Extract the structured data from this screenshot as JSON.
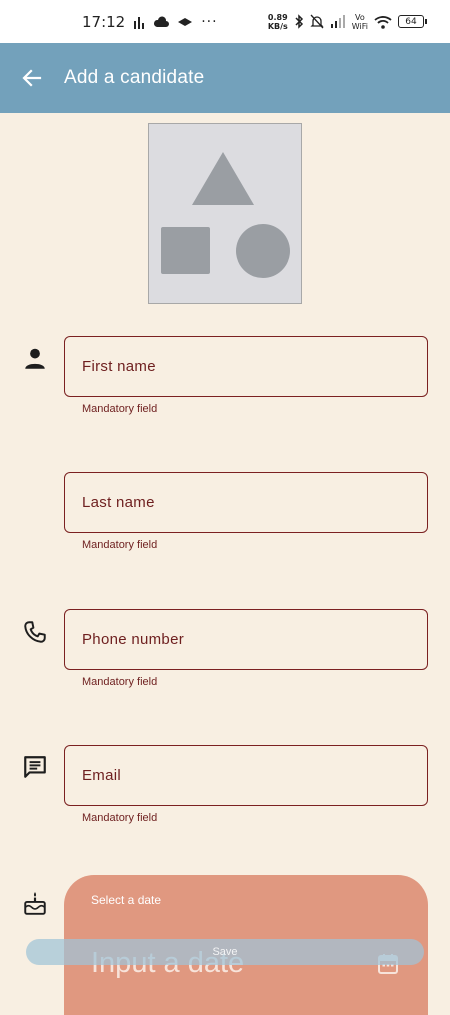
{
  "status_bar": {
    "time": "17:12",
    "speed_value": "0.89",
    "speed_unit": "KB/s",
    "vo_label": "Vo",
    "wifi_label": "WiFi",
    "battery": "64"
  },
  "app_bar": {
    "title": "Add a candidate",
    "back_icon": "arrow-left-icon"
  },
  "form": {
    "first_name": {
      "label": "First name",
      "helper": "Mandatory field",
      "icon": "person-icon"
    },
    "last_name": {
      "label": "Last name",
      "helper": "Mandatory field"
    },
    "phone": {
      "label": "Phone number",
      "helper": "Mandatory field",
      "icon": "phone-icon"
    },
    "email": {
      "label": "Email",
      "helper": "Mandatory field",
      "icon": "message-icon"
    },
    "birthdate": {
      "icon": "cake-icon"
    }
  },
  "date_picker": {
    "label": "Select a date",
    "input_placeholder": "Input a date",
    "icon": "calendar-icon"
  },
  "save_button": {
    "label": "Save"
  },
  "colors": {
    "app_bar": "#73a1bb",
    "background": "#f8efe2",
    "field_border": "#7b2121",
    "date_sheet": "#e09880"
  }
}
